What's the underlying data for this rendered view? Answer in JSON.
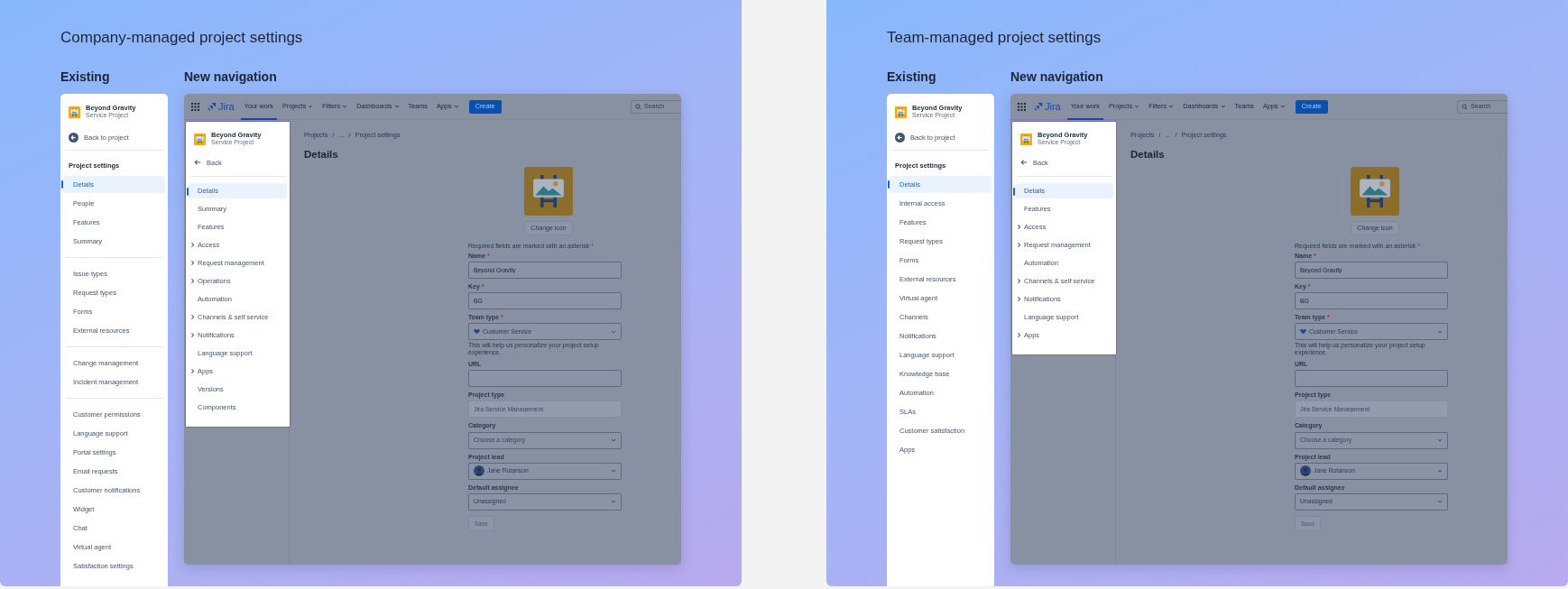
{
  "panels": [
    {
      "title": "Company-managed project settings",
      "existing": {
        "heading": "Existing",
        "project": {
          "name": "Beyond Gravity",
          "type": "Service Project"
        },
        "back": "Back to project",
        "section": "Project settings",
        "groups": [
          {
            "items": [
              {
                "label": "Details",
                "selected": true
              },
              {
                "label": "People",
                "selected": false
              },
              {
                "label": "Features",
                "selected": false
              },
              {
                "label": "Summary",
                "selected": false
              }
            ]
          },
          {
            "items": [
              {
                "label": "Issue types",
                "selected": false
              },
              {
                "label": "Request types",
                "selected": false
              },
              {
                "label": "Forms",
                "selected": false
              },
              {
                "label": "External resources",
                "selected": false
              }
            ]
          },
          {
            "items": [
              {
                "label": "Change management",
                "selected": false
              },
              {
                "label": "Incident management",
                "selected": false
              }
            ]
          },
          {
            "items": [
              {
                "label": "Customer permissions",
                "selected": false
              },
              {
                "label": "Language support",
                "selected": false
              },
              {
                "label": "Portal settings",
                "selected": false
              },
              {
                "label": "Email requests",
                "selected": false
              },
              {
                "label": "Customer notifications",
                "selected": false
              },
              {
                "label": "Widget",
                "selected": false
              },
              {
                "label": "Chat",
                "selected": false
              },
              {
                "label": "Virtual agent",
                "selected": false
              },
              {
                "label": "Satisfaction settings",
                "selected": false
              }
            ]
          }
        ]
      },
      "new_navigation": {
        "heading": "New navigation",
        "topbar": {
          "logo": "Jira",
          "items": [
            {
              "label": "Your work",
              "selected": true,
              "dropdown": false
            },
            {
              "label": "Projects",
              "selected": false,
              "dropdown": true
            },
            {
              "label": "Filters",
              "selected": false,
              "dropdown": true
            },
            {
              "label": "Dashboards",
              "selected": false,
              "dropdown": true
            },
            {
              "label": "Teams",
              "selected": false,
              "dropdown": false
            },
            {
              "label": "Apps",
              "selected": false,
              "dropdown": true
            }
          ],
          "create": "Create",
          "search": {
            "placeholder": "Search"
          }
        },
        "flyout": {
          "project": {
            "name": "Beyond Gravity",
            "type": "Service Project"
          },
          "back": "Back",
          "items": [
            {
              "label": "Details",
              "selected": true,
              "expandable": false
            },
            {
              "label": "Summary",
              "selected": false,
              "expandable": false
            },
            {
              "label": "Features",
              "selected": false,
              "expandable": false
            },
            {
              "label": "Access",
              "selected": false,
              "expandable": true
            },
            {
              "label": "Request management",
              "selected": false,
              "expandable": true
            },
            {
              "label": "Operations",
              "selected": false,
              "expandable": true
            },
            {
              "label": "Automation",
              "selected": false,
              "expandable": false
            },
            {
              "label": "Channels & self service",
              "selected": false,
              "expandable": true
            },
            {
              "label": "Notifications",
              "selected": false,
              "expandable": true
            },
            {
              "label": "Language support",
              "selected": false,
              "expandable": false
            },
            {
              "label": "Apps",
              "selected": false,
              "expandable": true
            },
            {
              "label": "Versions",
              "selected": false,
              "expandable": false
            },
            {
              "label": "Components",
              "selected": false,
              "expandable": false
            }
          ]
        },
        "breadcrumb": {
          "items": [
            "Projects",
            "...",
            "Project settings"
          ],
          "separator": "/"
        },
        "page_title": "Details",
        "change_icon": "Change icon",
        "required_note": {
          "text": "Required fields are marked with an asterisk",
          "asterisk": "*"
        },
        "fields": [
          {
            "kind": "text",
            "label": "Name",
            "asterisk": "*",
            "value": "Beyond Gravity",
            "disabled": false
          },
          {
            "kind": "text",
            "label": "Key",
            "asterisk": "*",
            "value": "BG",
            "disabled": false
          },
          {
            "kind": "team-select",
            "label": "Team type",
            "asterisk": "*",
            "value": "Customer Service",
            "help": "This will help us personalize your project setup experience.",
            "disabled": false
          },
          {
            "kind": "text",
            "label": "URL",
            "disabled": false
          },
          {
            "kind": "text",
            "label": "Project type",
            "value": "Jira Service Management",
            "disabled": true
          },
          {
            "kind": "select",
            "label": "Category",
            "placeholder": "Choose a category",
            "disabled": false
          },
          {
            "kind": "user-select",
            "label": "Project lead",
            "value": "Jane Rotanson",
            "disabled": false
          },
          {
            "kind": "select",
            "label": "Default assignee",
            "value": "Unassigned",
            "disabled": false
          }
        ],
        "save": "Save"
      }
    },
    {
      "title": "Team-managed project settings",
      "existing": {
        "heading": "Existing",
        "project": {
          "name": "Beyond Gravity",
          "type": "Service Project"
        },
        "back": "Back to project",
        "section": "Project settings",
        "groups": [
          {
            "items": [
              {
                "label": "Details",
                "selected": true
              },
              {
                "label": "Internal access",
                "selected": false
              },
              {
                "label": "Features",
                "selected": false
              },
              {
                "label": "Request types",
                "selected": false
              },
              {
                "label": "Forms",
                "selected": false
              },
              {
                "label": "External resources",
                "selected": false
              },
              {
                "label": "Virtual agent",
                "selected": false
              },
              {
                "label": "Channels",
                "selected": false
              },
              {
                "label": "Notifications",
                "selected": false
              },
              {
                "label": "Language support",
                "selected": false
              },
              {
                "label": "Knowledge base",
                "selected": false
              },
              {
                "label": "Automation",
                "selected": false
              },
              {
                "label": "SLAs",
                "selected": false
              },
              {
                "label": "Customer satisfaction",
                "selected": false
              },
              {
                "label": "Apps",
                "selected": false
              }
            ]
          }
        ]
      },
      "new_navigation": {
        "heading": "New navigation",
        "topbar": {
          "logo": "Jira",
          "items": [
            {
              "label": "Your work",
              "selected": true,
              "dropdown": false
            },
            {
              "label": "Projects",
              "selected": false,
              "dropdown": true
            },
            {
              "label": "Filters",
              "selected": false,
              "dropdown": true
            },
            {
              "label": "Dashboards",
              "selected": false,
              "dropdown": true
            },
            {
              "label": "Teams",
              "selected": false,
              "dropdown": false
            },
            {
              "label": "Apps",
              "selected": false,
              "dropdown": true
            }
          ],
          "create": "Create",
          "search": {
            "placeholder": "Search"
          }
        },
        "flyout": {
          "project": {
            "name": "Beyond Gravity",
            "type": "Service Project"
          },
          "back": "Back",
          "items": [
            {
              "label": "Details",
              "selected": true,
              "expandable": false
            },
            {
              "label": "Features",
              "selected": false,
              "expandable": false
            },
            {
              "label": "Access",
              "selected": false,
              "expandable": true
            },
            {
              "label": "Request management",
              "selected": false,
              "expandable": true
            },
            {
              "label": "Automation",
              "selected": false,
              "expandable": false
            },
            {
              "label": "Channels & self service",
              "selected": false,
              "expandable": true
            },
            {
              "label": "Notifications",
              "selected": false,
              "expandable": true
            },
            {
              "label": "Language support",
              "selected": false,
              "expandable": false
            },
            {
              "label": "Apps",
              "selected": false,
              "expandable": true
            }
          ]
        },
        "breadcrumb": {
          "items": [
            "Projects",
            "...",
            "Project settings"
          ],
          "separator": "/"
        },
        "page_title": "Details",
        "change_icon": "Change icon",
        "required_note": {
          "text": "Required fields are marked with an asterisk",
          "asterisk": "*"
        },
        "fields": [
          {
            "kind": "text",
            "label": "Name",
            "asterisk": "*",
            "value": "Beyond Gravity",
            "disabled": false
          },
          {
            "kind": "text",
            "label": "Key",
            "asterisk": "*",
            "value": "BG",
            "disabled": false
          },
          {
            "kind": "team-select",
            "label": "Team type",
            "asterisk": "*",
            "value": "Customer Service",
            "help": "This will help us personalize your project setup experience.",
            "disabled": false
          },
          {
            "kind": "text",
            "label": "URL",
            "disabled": false
          },
          {
            "kind": "text",
            "label": "Project type",
            "value": "Jira Service Management",
            "disabled": true
          },
          {
            "kind": "select",
            "label": "Category",
            "placeholder": "Choose a category",
            "disabled": false
          },
          {
            "kind": "user-select",
            "label": "Project lead",
            "value": "Jane Rotanson",
            "disabled": false
          },
          {
            "kind": "select",
            "label": "Default assignee",
            "value": "Unassigned",
            "disabled": false
          }
        ],
        "save": "Save"
      }
    }
  ]
}
